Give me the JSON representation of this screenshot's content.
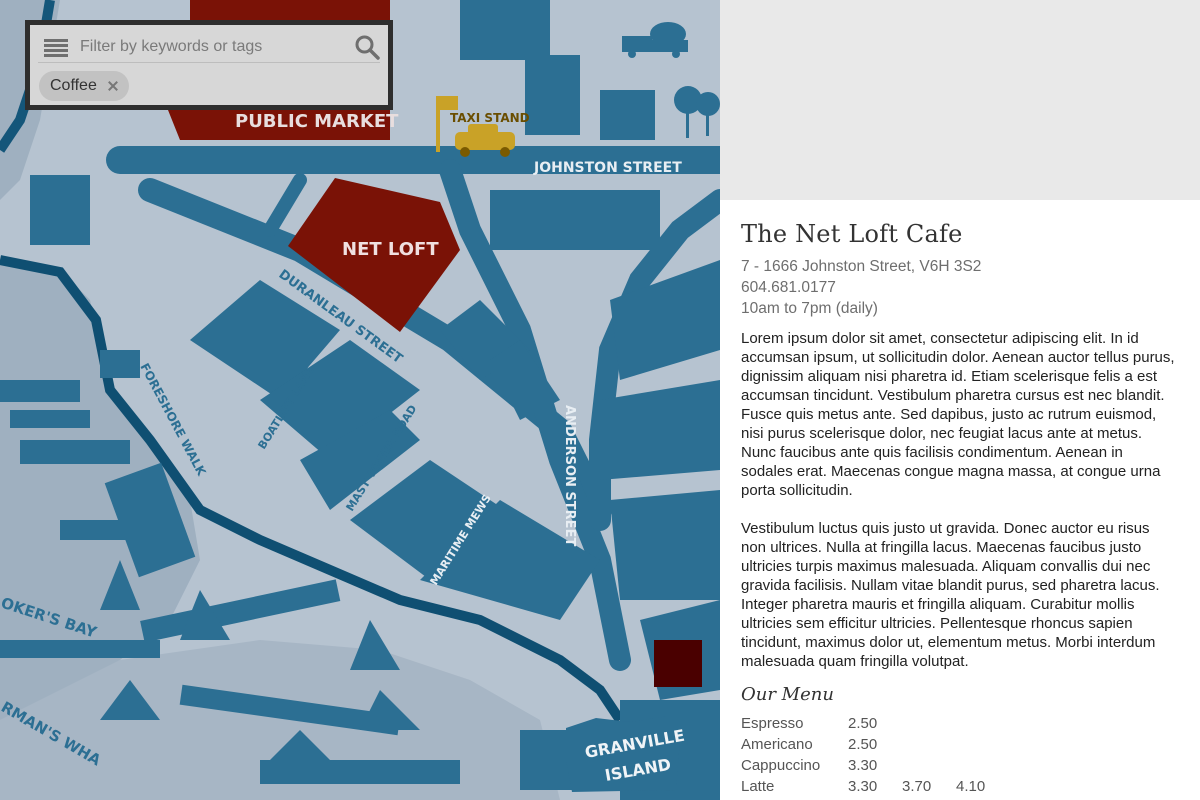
{
  "search": {
    "placeholder": "Filter by keywords or tags",
    "tags": [
      {
        "label": "Coffee"
      }
    ]
  },
  "map": {
    "labels": {
      "public_market": "PUBLIC MARKET",
      "taxi_stand": "TAXI STAND",
      "johnston_street": "JOHNSTON STREET",
      "net_loft": "NET LOFT",
      "duranleau_street": "DURANLEAU STREET",
      "anderson_street": "ANDERSON STREET",
      "foreshore_walk": "FORESHORE WALK",
      "boatlift_lane": "BOATLIFT LANE",
      "mast_tower_road": "MAST TOWER ROAD",
      "maritime_mews": "MARITIME MEWS",
      "brokers_bay": "OKER'S BAY",
      "fishermans_wharf": "RMAN'S WHA",
      "granville_island_1": "GRANVILLE",
      "granville_island_2": "ISLAND"
    },
    "colors": {
      "land": "#b6c3d0",
      "building": "#2c6f93",
      "road": "#2c6f93",
      "highlight": "#7a1206",
      "dark_highlight": "#4a0000",
      "taxi": "#c9a227"
    }
  },
  "place": {
    "title": "The Net Loft Cafe",
    "address": "7 - 1666 Johnston Street, V6H 3S2",
    "phone": "604.681.0177",
    "hours": "10am to 7pm (daily)",
    "description": [
      "Lorem ipsum dolor sit amet, consectetur adipiscing elit. In id accumsan ipsum, ut sollicitudin dolor. Aenean auctor tellus purus, dignissim aliquam nisi pharetra id. Etiam scelerisque felis a est accumsan tincidunt. Vestibulum pharetra cursus est nec blandit. Fusce quis metus ante. Sed dapibus, justo ac rutrum euismod, nisi purus scelerisque dolor, nec feugiat lacus ante at metus. Nunc faucibus ante quis facilisis condimentum. Aenean in sodales erat. Maecenas congue magna massa, at congue urna porta sollicitudin.",
      "Vestibulum luctus quis justo ut gravida. Donec auctor eu risus non ultrices. Nulla at fringilla lacus. Maecenas faucibus justo ultricies turpis maximus malesuada. Aliquam convallis dui nec gravida facilisis. Nullam vitae blandit purus, sed pharetra lacus. Integer pharetra mauris et fringilla aliquam. Curabitur mollis ultricies sem efficitur ultricies. Pellentesque rhoncus sapien tincidunt, maximus dolor ut, elementum metus. Morbi interdum malesuada quam fringilla volutpat."
    ],
    "menu_title": "Our Menu",
    "menu": [
      {
        "name": "Espresso",
        "prices": [
          "2.50"
        ]
      },
      {
        "name": "Americano",
        "prices": [
          "2.50"
        ]
      },
      {
        "name": "Cappuccino",
        "prices": [
          "3.30"
        ]
      },
      {
        "name": "Latte",
        "prices": [
          "3.30",
          "3.70",
          "4.10"
        ]
      }
    ]
  }
}
